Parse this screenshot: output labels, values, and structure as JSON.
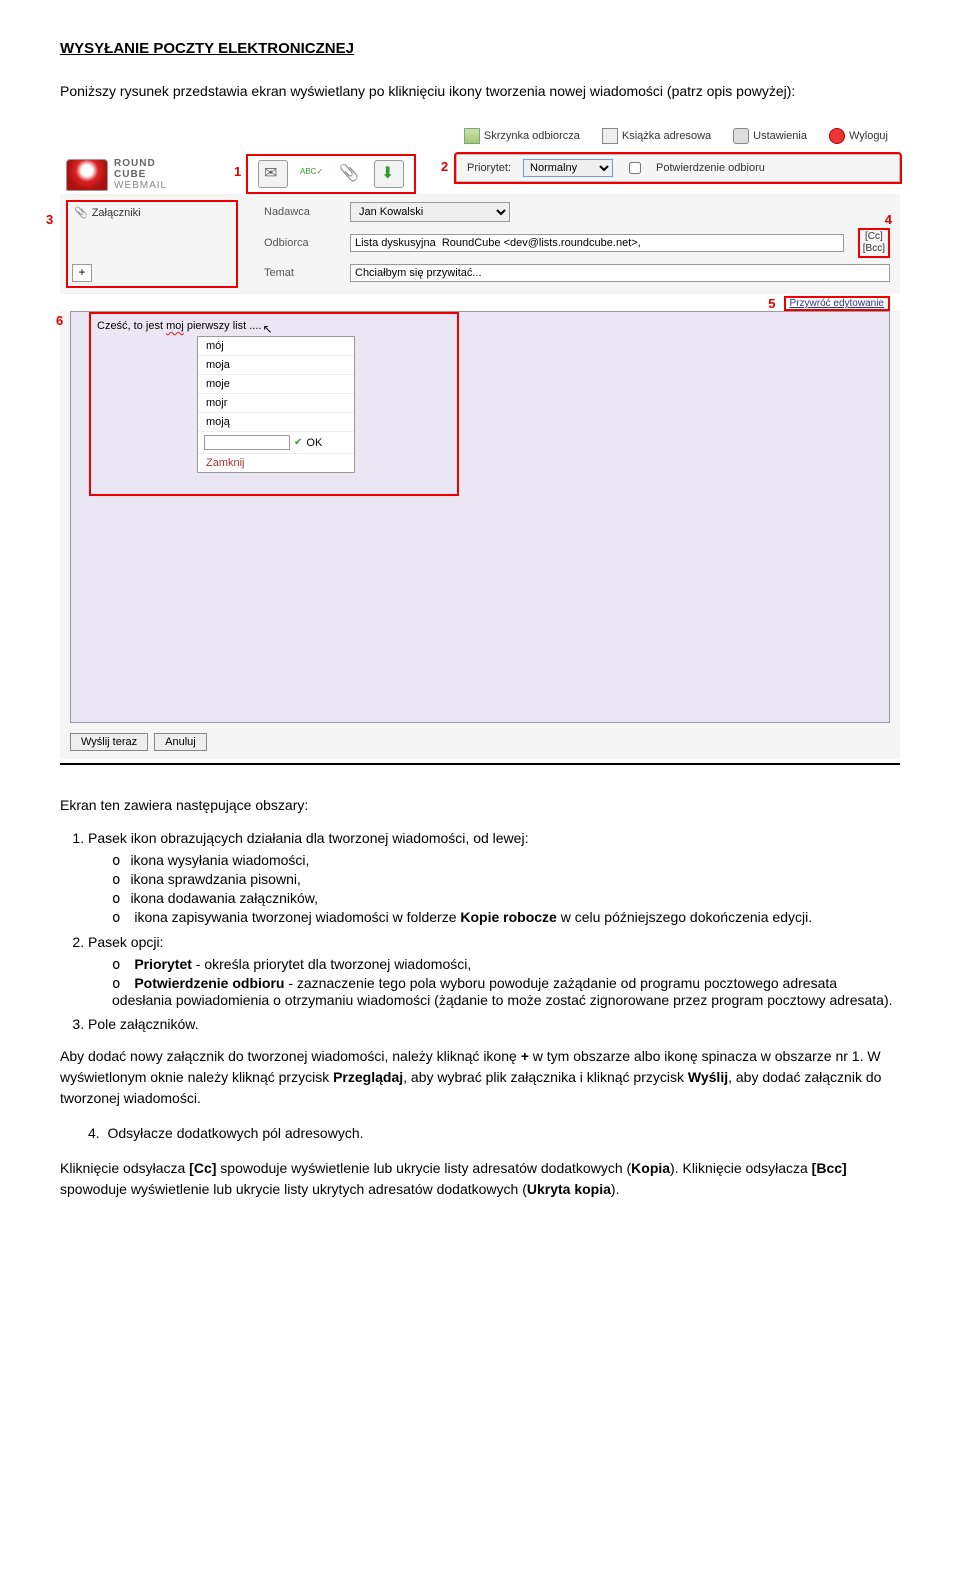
{
  "doc": {
    "title": "WYSYŁANIE POCZTY ELEKTRONICZNEJ",
    "intro": "Poniższy rysunek przedstawia ekran wyświetlany po kliknięciu ikony tworzenia nowej wiadomości (patrz opis powyżej):",
    "after_screenshot": "Ekran ten zawiera następujące obszary:",
    "list1_lead": "Pasek ikon obrazujących działania dla tworzonej wiadomości, od lewej:",
    "list1_items": {
      "a": "ikona wysyłania wiadomości,",
      "b": "ikona sprawdzania pisowni,",
      "c": "ikona dodawania załączników,",
      "d_pre": "ikona zapisywania tworzonej wiadomości w folderze ",
      "d_bold": "Kopie robocze",
      "d_post": " w celu późniejszego dokończenia edycji."
    },
    "list2_lead": "Pasek opcji:",
    "list2_a_bold": "Priorytet",
    "list2_a_post": " - określa priorytet dla tworzonej wiadomości,",
    "list2_b_bold": "Potwierdzenie odbioru",
    "list2_b_post": " - zaznaczenie tego pola wyboru powoduje zażądanie od programu pocztowego adresata odesłania powiadomienia o otrzymaniu wiadomości (żądanie to może zostać zignorowane przez program pocztowy adresata).",
    "list3": "Pole załączników.",
    "para_attach_pre": "Aby dodać nowy załącznik do tworzonej wiadomości, należy kliknąć ikonę ",
    "para_attach_plus": "+",
    "para_attach_mid": " w tym obszarze albo ikonę spinacza w obszarze nr 1. W wyświetlonym oknie należy kliknąć przycisk ",
    "para_attach_b1": "Przeglądaj",
    "para_attach_mid2": ", aby wybrać plik załącznika i kliknąć przycisk ",
    "para_attach_b2": "Wyślij",
    "para_attach_end": ", aby dodać załącznik do tworzonej wiadomości.",
    "list4": "Odsyłacze dodatkowych pól adresowych.",
    "para_cc_pre": "Kliknięcie odsyłacza ",
    "para_cc_b1": "[Cc]",
    "para_cc_mid": " spowoduje wyświetlenie lub ukrycie listy adresatów dodatkowych (",
    "para_cc_b2": "Kopia",
    "para_cc_mid2": "). Kliknięcie odsyłacza ",
    "para_cc_b3": "[Bcc]",
    "para_cc_mid3": " spowoduje wyświetlenie lub ukrycie listy ukrytych adresatów dodatkowych (",
    "para_cc_b4": "Ukryta kopia",
    "para_cc_end": ")."
  },
  "nums": {
    "n1": "1",
    "n2": "2",
    "n3": "3",
    "n4": "4",
    "n5": "5",
    "n6": "6"
  },
  "nav": {
    "inbox": "Skrzynka odbiorcza",
    "addressbook": "Książka adresowa",
    "settings": "Ustawienia",
    "logout": "Wyloguj"
  },
  "logo": {
    "line1": "ROUND",
    "line2": "CUBE",
    "line3": "WEBMAIL"
  },
  "options": {
    "priority_label": "Priorytet:",
    "priority_value": "Normalny",
    "confirm_label": "Potwierdzenie odbioru"
  },
  "attach": {
    "title": "Załączniki",
    "plus": "+"
  },
  "headers": {
    "from_label": "Nadawca",
    "from_value": "Jan Kowalski",
    "to_label": "Odbiorca",
    "to_value": "Lista dyskusyjna  RoundCube <dev@lists.roundcube.net>,",
    "cc": "[Cc]",
    "bcc": "[Bcc]",
    "subject_label": "Temat",
    "subject_value": "Chciałbym się przywitać..."
  },
  "restore": {
    "label": "Przywróć edytowanie"
  },
  "editor": {
    "text_pre": "Cześć, to jest ",
    "text_miss": "moj",
    "text_post": " pierwszy list ....",
    "suggestions": {
      "s1": "mój",
      "s2": "moja",
      "s3": "moje",
      "s4": "mojr",
      "s5": "moją"
    },
    "ok": "OK",
    "close": "Zamknij"
  },
  "buttons": {
    "send_now": "Wyślij teraz",
    "cancel": "Anuluj"
  }
}
